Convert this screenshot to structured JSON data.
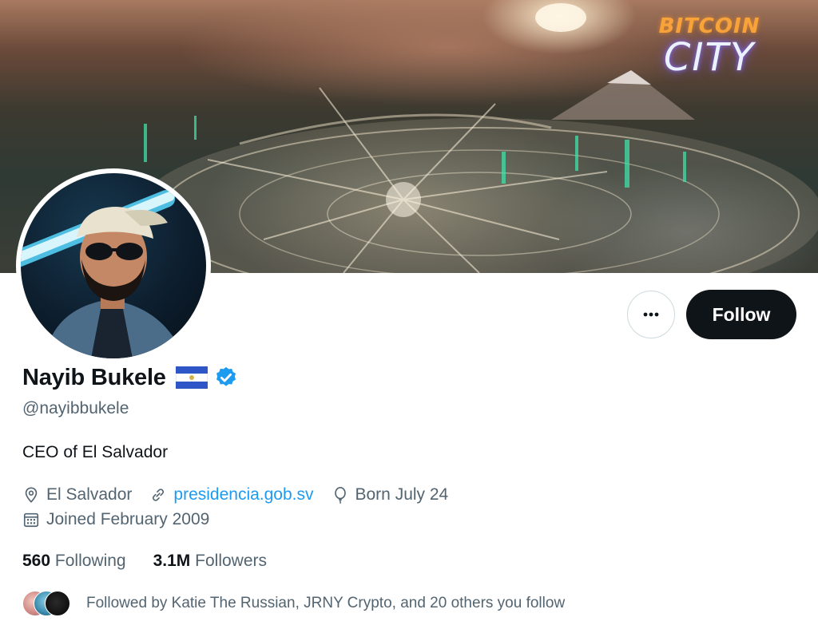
{
  "banner": {
    "logo_line1": "BITCOIN",
    "logo_line2": "CITY"
  },
  "profile": {
    "name": "Nayib Bukele",
    "flag": "el-salvador-flag",
    "verified_icon": "verified-badge-icon",
    "handle": "@nayibbukele",
    "bio": "CEO of El Salvador",
    "location": "El Salvador",
    "website": "presidencia.gob.sv",
    "birthday": "Born July 24",
    "joined": "Joined February 2009"
  },
  "actions": {
    "more_icon": "more-icon",
    "follow_label": "Follow"
  },
  "stats": {
    "following_count": "560",
    "following_label": "Following",
    "followers_count": "3.1M",
    "followers_label": "Followers"
  },
  "followed_by": {
    "text": "Followed by Katie The Russian, JRNY Crypto, and 20 others you follow"
  },
  "colors": {
    "accent": "#1d9bf0",
    "text_primary": "#0f1419",
    "text_secondary": "#536471",
    "button_dark": "#0f1419",
    "border": "#cfd9de"
  }
}
